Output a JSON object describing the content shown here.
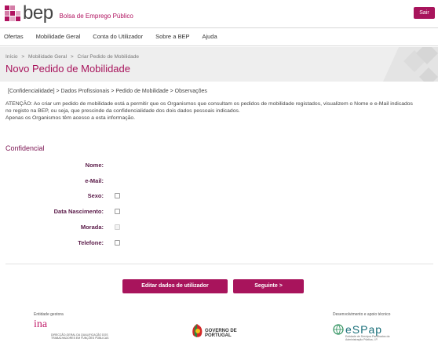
{
  "header": {
    "logo_text": "bep",
    "logo_subtitle": "Bolsa de Emprego Público",
    "exit_label": "Sair"
  },
  "nav": {
    "items": [
      "Ofertas",
      "Mobilidade Geral",
      "Conta do Utilizador",
      "Sobre a BEP",
      "Ajuda"
    ]
  },
  "breadcrumb": {
    "items": [
      "Início",
      "Mobilidade Geral",
      "Criar Pedido de Mobilidade"
    ],
    "separator": ">"
  },
  "page": {
    "title": "Novo Pedido de Mobilidade",
    "steps": "[Confidencialidade] > Dados Profissionais > Pedido de Mobilidade > Observações",
    "notice_line1": "ATENÇÃO: Ao criar um pedido de mobilidade está a permitir que os Organismos que consultam os pedidos de mobilidade registados, visualizem o Nome e e-Mail indicados",
    "notice_line2": "no registo na BEP, ou seja, que prescinde da confidencialidade dos dois dados pessoais indicados.",
    "notice_line3": "Apenas os Organismos têm acesso a esta informação."
  },
  "form": {
    "section_title": "Confidencial",
    "fields": [
      {
        "label": "Nome:",
        "checkbox": false
      },
      {
        "label": "e-Mail:",
        "checkbox": false
      },
      {
        "label": "Sexo:",
        "checkbox": true,
        "disabled": false
      },
      {
        "label": "Data Nascimento:",
        "checkbox": true,
        "disabled": false
      },
      {
        "label": "Morada:",
        "checkbox": true,
        "disabled": true
      },
      {
        "label": "Telefone:",
        "checkbox": true,
        "disabled": false
      }
    ]
  },
  "actions": {
    "edit_label": "Editar dados de utilizador",
    "next_label": "Seguinte >"
  },
  "footer": {
    "left_caption": "Entidade gestora",
    "left_mark": "ina",
    "left_text": "DIRECÇÃO-GERAL DA QUALIFICAÇÃO DOS TRABALHADORES EM FUNÇÕES PÚBLICAS",
    "center_text_1": "GOVERNO DE",
    "center_text_2": "PORTUGAL",
    "right_caption": "Desenvolvimento e apoio técnico",
    "right_mark": "eSPap",
    "right_text": "Entidade de Serviços Partilhados da Administração Pública, I.P."
  },
  "colors": {
    "brand": "#a8145c",
    "section": "#7a1150",
    "banner_bg": "#eeeeee"
  }
}
